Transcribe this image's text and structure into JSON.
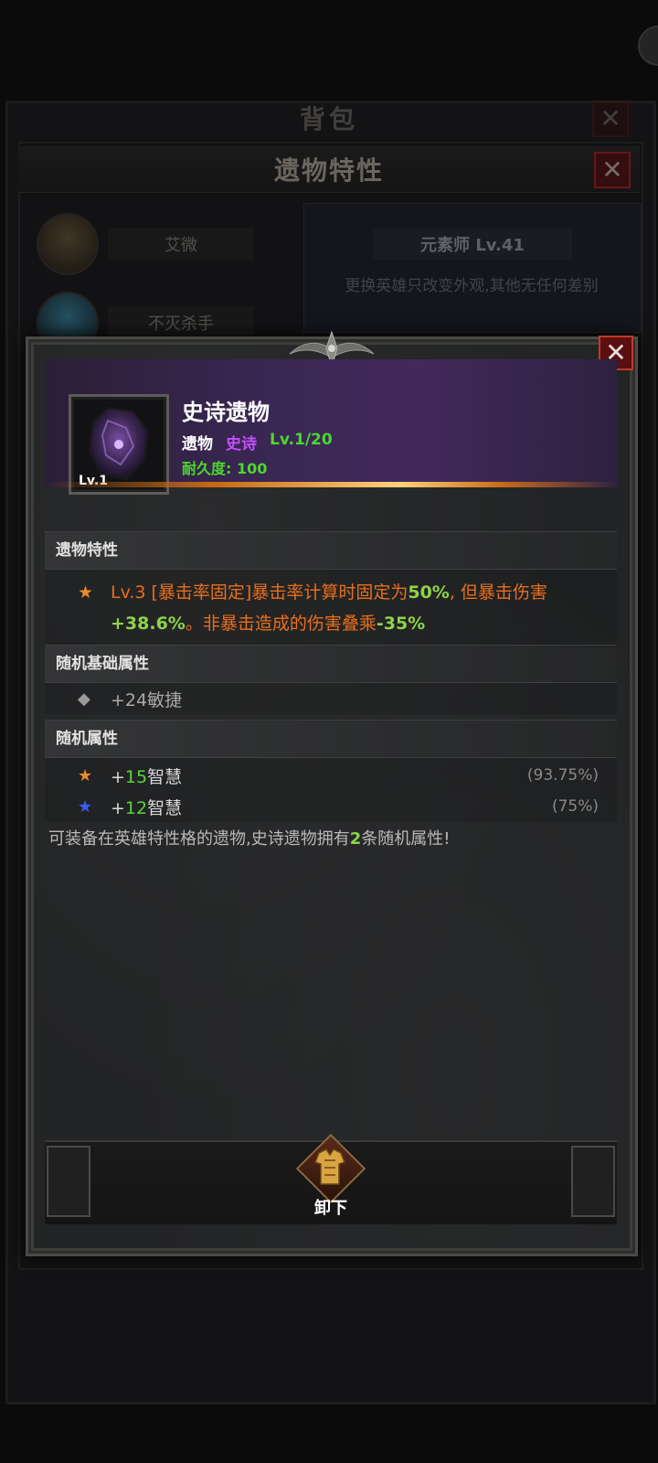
{
  "background": {
    "bag_title": "背包",
    "panel_title": "遗物特性",
    "heroes": [
      {
        "name": "艾微"
      },
      {
        "name": "不灭杀手"
      }
    ],
    "class_label": "元素师 Lv.41",
    "note": "更换英雄只改变外观,其他无任何差别"
  },
  "popup": {
    "close_label": "✕",
    "item": {
      "level_badge": "Lv.1",
      "name": "史诗遗物",
      "type": "遗物",
      "rarity": "史诗",
      "level": "Lv.1/20",
      "durability": "耐久度: 100"
    },
    "sections": {
      "trait": {
        "title": "遗物特性",
        "star": "★",
        "text_a": "Lv.3 [暴击率固定]暴击率计算时固定为",
        "hl_a": "50%",
        "text_b": ", 但暴击伤害",
        "hl_b": "+38.6%",
        "text_c": "。非暴击造成的伤害叠乘",
        "hl_c": "-35%"
      },
      "base": {
        "title": "随机基础属性",
        "rows": [
          {
            "glyph": "◆",
            "text": "+24敏捷"
          }
        ]
      },
      "random": {
        "title": "随机属性",
        "rows": [
          {
            "glyph": "★",
            "prefix": "+",
            "value": "15",
            "name": "智慧",
            "pct": "(93.75%)"
          },
          {
            "glyph": "★",
            "prefix": "+",
            "value": "12",
            "name": "智慧",
            "pct": "(75%)"
          }
        ]
      }
    },
    "description": {
      "text_a": "可装备在英雄特性格的遗物,史诗遗物拥有",
      "num": "2",
      "text_b": "条随机属性!"
    },
    "unequip_label": "卸下"
  },
  "colors": {
    "rarity_epic": "#c84cff",
    "level_green": "#4ad82b",
    "trait_orange": "#e86f1d",
    "star_orange": "#e88b2a",
    "star_blue": "#3a5cf0",
    "close_red": "#c0392b"
  }
}
